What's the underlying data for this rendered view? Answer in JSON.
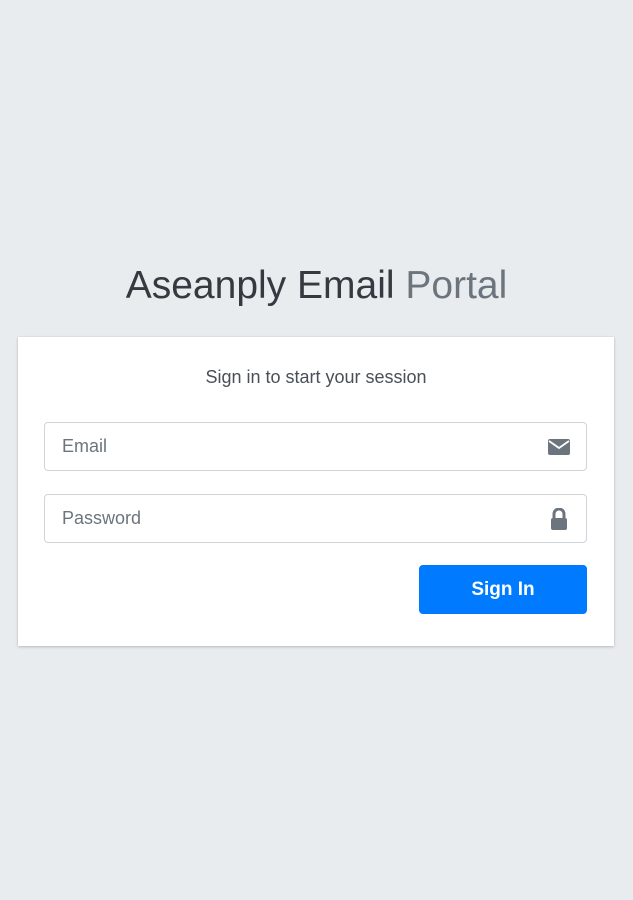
{
  "header": {
    "title_strong": "Aseanply Email",
    "title_light": "Portal"
  },
  "card": {
    "message": "Sign in to start your session",
    "email": {
      "placeholder": "Email",
      "value": "",
      "icon": "envelope-icon"
    },
    "password": {
      "placeholder": "Password",
      "value": "",
      "icon": "lock-icon"
    },
    "submit_label": "Sign In"
  },
  "colors": {
    "background": "#e9ecef",
    "primary": "#007bff",
    "icon": "#6c757d"
  }
}
